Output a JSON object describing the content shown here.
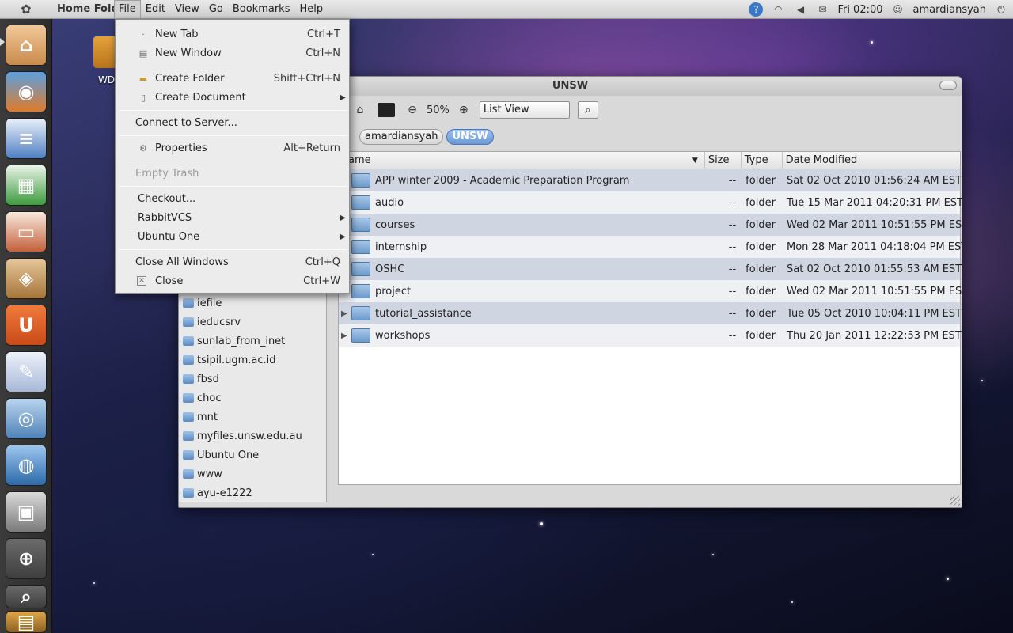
{
  "top_panel": {
    "app_title": "Home Fold",
    "menus": [
      "File",
      "Edit",
      "View",
      "Go",
      "Bookmarks",
      "Help"
    ],
    "clock": "Fri 02:00",
    "username": "amardiansyah",
    "tray_icons": [
      "help-icon",
      "wifi-icon",
      "volume-icon",
      "mail-icon",
      "user-icon",
      "power-icon"
    ]
  },
  "launcher": {
    "apps": [
      "Home Folder",
      "Firefox",
      "Writer",
      "Calc",
      "Impress",
      "Software Center",
      "Ubuntu One",
      "Text Editor",
      "Camera",
      "Chromium",
      "Workspaces",
      "Search",
      "Search Files",
      "Trash"
    ]
  },
  "desktop": {
    "icon_label": "WD"
  },
  "window": {
    "title": "UNSW",
    "zoom": "50%",
    "view_mode": "List View",
    "breadcrumbs": [
      "amardiansyah",
      "UNSW"
    ],
    "sidebar_items": [
      "iefile",
      "ieducsrv",
      "sunlab_from_inet",
      "tsipil.ugm.ac.id",
      "fbsd",
      "choc",
      "mnt",
      "myfiles.unsw.edu.au",
      "Ubuntu One",
      "www",
      "ayu-e1222"
    ],
    "columns": {
      "name": "ame",
      "size": "Size",
      "type": "Type",
      "date": "Date Modified"
    },
    "rows": [
      {
        "name": "APP winter 2009 - Academic Preparation Program",
        "size": "--",
        "type": "folder",
        "date": "Sat 02 Oct 2010 01:56:24 AM EST"
      },
      {
        "name": "audio",
        "size": "--",
        "type": "folder",
        "date": "Tue 15 Mar 2011 04:20:31 PM EST"
      },
      {
        "name": "courses",
        "size": "--",
        "type": "folder",
        "date": "Wed 02 Mar 2011 10:51:55 PM EST"
      },
      {
        "name": "internship",
        "size": "--",
        "type": "folder",
        "date": "Mon 28 Mar 2011 04:18:04 PM EST"
      },
      {
        "name": "OSHC",
        "size": "--",
        "type": "folder",
        "date": "Sat 02 Oct 2010 01:55:53 AM EST"
      },
      {
        "name": "project",
        "size": "--",
        "type": "folder",
        "date": "Wed 02 Mar 2011 10:51:55 PM EST"
      },
      {
        "name": "tutorial_assistance",
        "size": "--",
        "type": "folder",
        "date": "Tue 05 Oct 2010 10:04:11 PM EST"
      },
      {
        "name": "workshops",
        "size": "--",
        "type": "folder",
        "date": "Thu 20 Jan 2011 12:22:53 PM EST"
      }
    ]
  },
  "file_menu": {
    "new_tab": {
      "label": "New Tab",
      "accel": "Ctrl+T"
    },
    "new_window": {
      "label": "New Window",
      "accel": "Ctrl+N"
    },
    "create_folder": {
      "label": "Create Folder",
      "accel": "Shift+Ctrl+N"
    },
    "create_document": {
      "label": "Create Document"
    },
    "connect_server": {
      "label": "Connect to Server..."
    },
    "properties": {
      "label": "Properties",
      "accel": "Alt+Return"
    },
    "empty_trash": {
      "label": "Empty Trash"
    },
    "checkout": {
      "label": "Checkout..."
    },
    "rabbitvcs": {
      "label": "RabbitVCS"
    },
    "ubuntu_one": {
      "label": "Ubuntu One"
    },
    "close_all": {
      "label": "Close All Windows",
      "accel": "Ctrl+Q"
    },
    "close": {
      "label": "Close",
      "accel": "Ctrl+W"
    }
  }
}
